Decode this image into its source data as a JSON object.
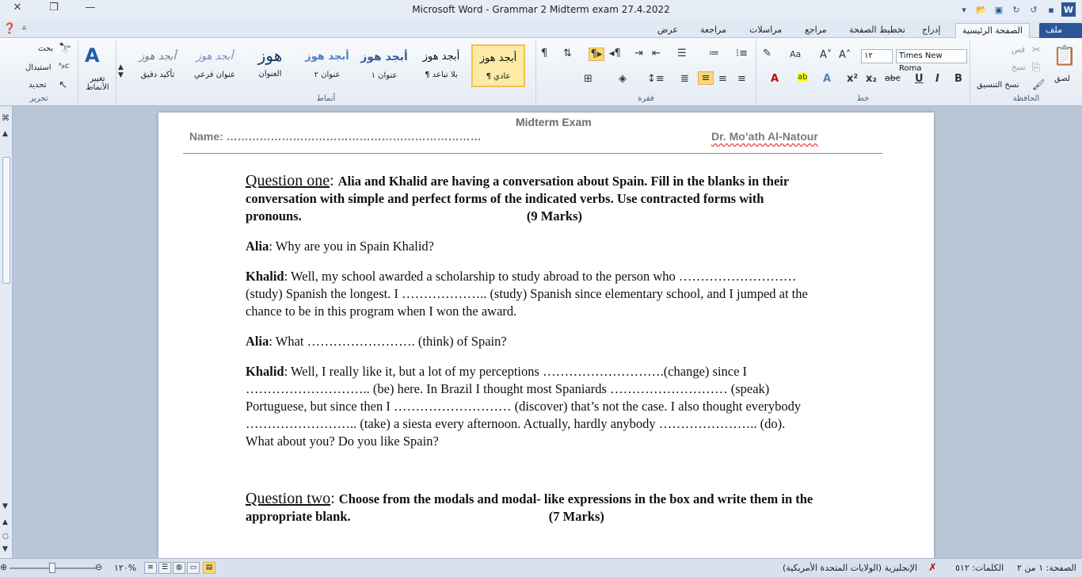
{
  "window": {
    "title": "Microsoft Word  -  Grammar 2 Midterm exam 27.4.2022"
  },
  "tabs": [
    "ملف",
    "الصفحة الرئيسية",
    "إدراج",
    "تخطيط الصفحة",
    "مراجع",
    "مراسلات",
    "مراجعة",
    "عرض"
  ],
  "ribbon": {
    "clipboard": {
      "paste": "لصق",
      "cut": "قص",
      "copy": "نسخ",
      "format_painter": "نسخ التنسيق",
      "label": "الحافظة"
    },
    "font": {
      "name": "Times New Roma",
      "size": "١٢",
      "label": "خط"
    },
    "paragraph": {
      "label": "فقرة"
    },
    "styles": {
      "label": "أنماط",
      "items": [
        {
          "preview": "أبجد هوز",
          "name": "¶ عادي"
        },
        {
          "preview": "أبجد هوز",
          "name": "¶ بلا تباعد"
        },
        {
          "preview": "أبجد هوز",
          "name": "عنوان ١"
        },
        {
          "preview": "أبجد هوز",
          "name": "عنوان ٢"
        },
        {
          "preview": "هوز",
          "name": "العنوان"
        },
        {
          "preview": "أبجد هوز",
          "name": "عنوان فرعي"
        },
        {
          "preview": "أبجد هوز",
          "name": "تأكيد دقيق"
        }
      ],
      "change_styles": "تغيير الأنماط"
    },
    "editing": {
      "find": "بحث",
      "replace": "استبدال",
      "select": "تحديد",
      "label": "تحرير"
    }
  },
  "document": {
    "header": {
      "title": "Midterm Exam",
      "name": "Name: ……………………………………………………………",
      "doctor": "Dr. Mo’ath Al-Natour"
    },
    "q1": {
      "heading": "Question one",
      "instructions": "Alia and Khalid are having a conversation about Spain. Fill in the blanks in their conversation with simple and perfect forms of the indicated verbs. Use contracted forms with pronouns.",
      "marks": "(9 Marks)"
    },
    "dialog": [
      {
        "speaker": "Alia",
        "text": ": Why are you in Spain Khalid?"
      },
      {
        "speaker": "Khalid",
        "text": ": Well, my school awarded a scholarship to study abroad to the person who ……………………… (study) Spanish the longest. I ……………….. (study) Spanish since elementary school, and I jumped at the chance to be in this program when I won the award."
      },
      {
        "speaker": "Alia",
        "text": ": What ……………………. (think) of Spain?"
      },
      {
        "speaker": "Khalid",
        "text": ": Well, I really like it, but a lot of my perceptions ……………………….(change) since I ……………………….. (be) here. In Brazil I thought most Spaniards ……………………… (speak) Portuguese, but since then I ……………………… (discover) that’s not the case. I also thought everybody …………………….. (take) a siesta every afternoon. Actually, hardly anybody ………………….. (do). What about you? Do you like Spain?"
      }
    ],
    "q2": {
      "heading": "Question two",
      "instructions": "Choose from the modals and modal- like expressions in the box and write them in the appropriate blank.",
      "marks": "(7 Marks)"
    }
  },
  "status": {
    "page": "الصفحة: ١ من ٢",
    "words": "الكلمات: ٥١٢",
    "language": "الإنجليزية (الولايات المتحدة الأمريكية)",
    "zoom": "١٢٠%"
  },
  "colors": {
    "file_tab": "#2a5699",
    "accent": "#2b5797"
  }
}
